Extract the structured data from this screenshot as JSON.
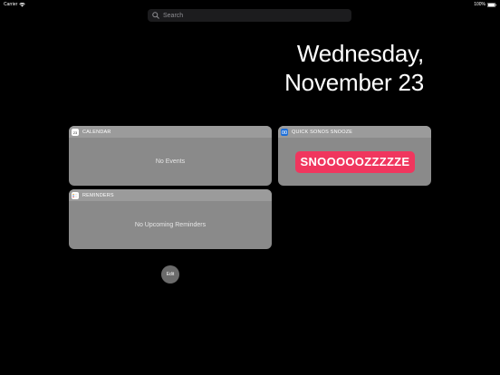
{
  "status_bar": {
    "carrier": "Carrier",
    "time": "",
    "battery": "100%"
  },
  "search": {
    "placeholder": "Search"
  },
  "date": {
    "line1": "Wednesday,",
    "line2": "November 23"
  },
  "widgets": {
    "calendar": {
      "title": "CALENDAR",
      "empty_text": "No Events",
      "icon": "calendar-icon",
      "icon_number": "23"
    },
    "reminders": {
      "title": "REMINDERS",
      "empty_text": "No Upcoming Reminders",
      "icon": "reminders-icon"
    },
    "sonos": {
      "title": "QUICK SONOS SNOOZE",
      "button_label": "SNOOOOOZZZZZE",
      "icon": "sonos-icon",
      "accent_color": "#f0365e"
    }
  },
  "edit_button": {
    "label": "Edit"
  }
}
